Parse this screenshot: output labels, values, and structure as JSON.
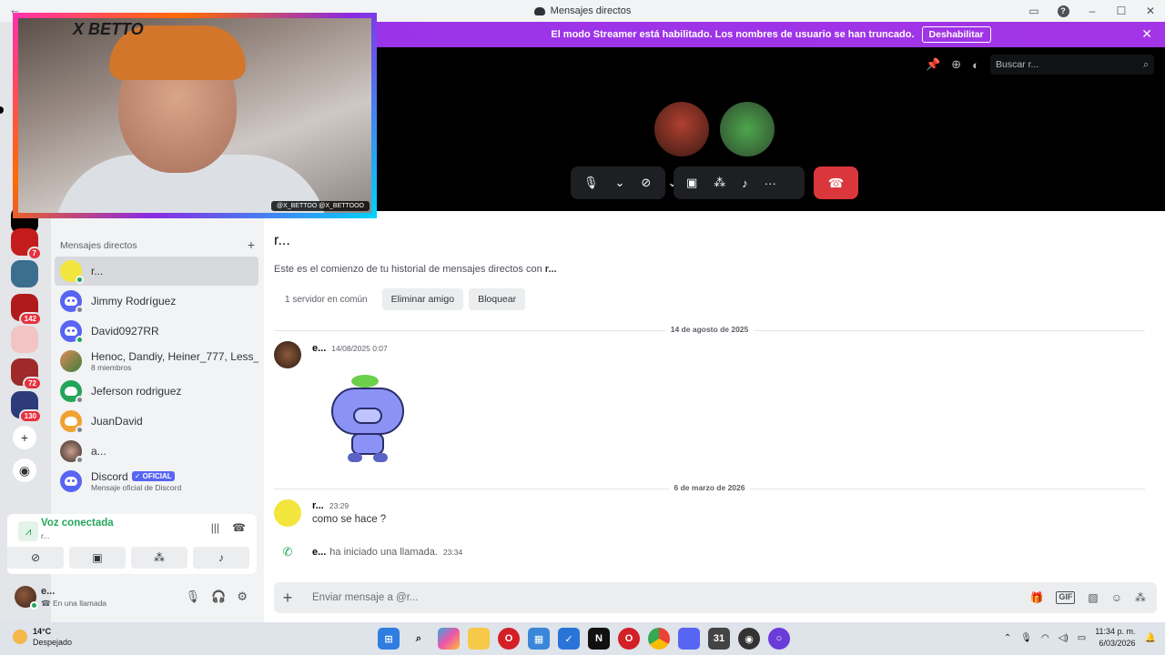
{
  "window": {
    "title": "Mensajes directos"
  },
  "banner": {
    "text": "El modo Streamer está habilitado. Los nombres de usuario se han truncado.",
    "button": "Deshabilitar"
  },
  "rail": {
    "badges": [
      "7",
      "142",
      "72",
      "130"
    ]
  },
  "sidebar": {
    "section_title": "Mensajes directos",
    "items": [
      {
        "name": "r...",
        "sub": ""
      },
      {
        "name": "Jimmy Rodríguez",
        "sub": ""
      },
      {
        "name": "David0927RR",
        "sub": ""
      },
      {
        "name": "Henoc, Dandiy, Heiner_777, Less_...",
        "sub": "8 miembros"
      },
      {
        "name": "Jeferson rodriguez",
        "sub": ""
      },
      {
        "name": "JuanDavid",
        "sub": ""
      },
      {
        "name": "a...",
        "sub": ""
      },
      {
        "name": "Discord",
        "badge": "OFICIAL",
        "sub": "Mensaje oficial de Discord"
      }
    ]
  },
  "voice": {
    "title": "Voz conectada",
    "sub": "r..."
  },
  "user": {
    "name": "e...",
    "status": "En una llamada"
  },
  "call": {
    "search_placeholder": "Buscar r..."
  },
  "chat": {
    "header": "r...",
    "intro_prefix": "Este es el comienzo de tu historial de mensajes directos con ",
    "intro_name": "r...",
    "common": "1 servidor en común",
    "remove_friend": "Eliminar amigo",
    "block": "Bloquear",
    "sep1": "14 de agosto de 2025",
    "msg1": {
      "author": "e...",
      "time": "14/08/2025 0:07"
    },
    "sep2": "6 de marzo de 2026",
    "msg2": {
      "author": "r...",
      "time": "23:29",
      "text": "como se hace ?"
    },
    "sys": {
      "author": "e...",
      "text": "ha iniciado una llamada.",
      "time": "23:34"
    },
    "composer_placeholder": "Enviar mensaje a @r..."
  },
  "cam": {
    "logo": "X BETTO",
    "handles": "@X_BETTOO  @X_BETTOOO"
  },
  "taskbar": {
    "temp": "14°C",
    "weather": "Despejado",
    "time": "11:34 p. m.",
    "date": "6/03/2026"
  },
  "colors": {
    "accent": "#5865f2",
    "banner": "#a235e6",
    "online": "#23a55a",
    "danger": "#da373c"
  }
}
